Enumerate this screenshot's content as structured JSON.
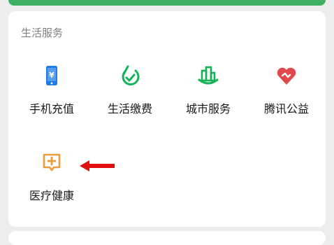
{
  "section": {
    "title": "生活服务"
  },
  "services": [
    {
      "label": "手机充值",
      "icon": "mobile-recharge-icon",
      "color": "#1e7ce6"
    },
    {
      "label": "生活缴费",
      "icon": "utility-payment-icon",
      "color": "#15b25a"
    },
    {
      "label": "城市服务",
      "icon": "city-services-icon",
      "color": "#15b25a"
    },
    {
      "label": "腾讯公益",
      "icon": "tencent-charity-icon",
      "color": "#e0484d"
    },
    {
      "label": "医疗健康",
      "icon": "medical-health-icon",
      "color": "#ed9a3c"
    }
  ],
  "annotation": {
    "arrow_color": "#e01010"
  }
}
